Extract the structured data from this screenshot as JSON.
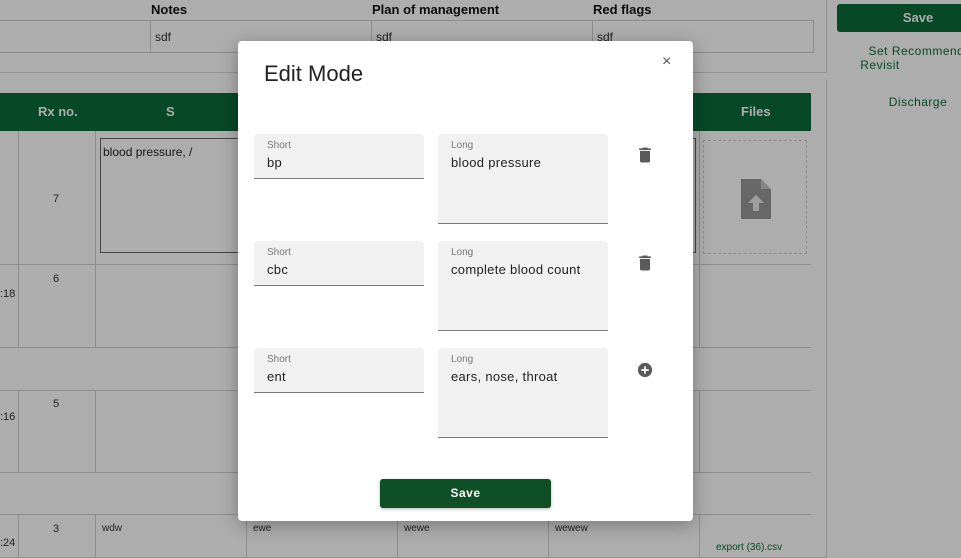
{
  "header": {
    "notes_label": "Notes",
    "plan_label": "Plan of management",
    "redflags_label": "Red flags",
    "notes_value": "sdf",
    "plan_value": "sdf",
    "redflags_value": "sdf"
  },
  "side": {
    "save_label": "Save",
    "set_recommended_label": "Set Recommende",
    "revisit_label": "Revisit",
    "discharge_label": "Discharge"
  },
  "table": {
    "columns": [
      "Rx no.",
      "S",
      "Files"
    ],
    "rows": [
      {
        "rx": "7",
        "time": "",
        "s": "blood pressure, /"
      },
      {
        "rx": "6",
        "time": ":18",
        "s": ""
      },
      {
        "rx": "5",
        "time": ":16",
        "s": ""
      },
      {
        "rx": "3",
        "time": ":24",
        "s": "wdw",
        "c2": "ewe",
        "c3": "wewe",
        "c4": "wewew",
        "file": "export (36).csv"
      }
    ]
  },
  "modal": {
    "title": "Edit Mode",
    "close": "×",
    "short_label": "Short",
    "long_label": "Long",
    "entries": [
      {
        "short": "bp",
        "long": "blood pressure",
        "action": "delete-icon"
      },
      {
        "short": "cbc",
        "long": "complete blood count",
        "action": "delete-icon"
      },
      {
        "short": "ent",
        "long": "ears, nose, throat",
        "action": "add-circle-icon"
      }
    ],
    "save_label": "Save"
  }
}
